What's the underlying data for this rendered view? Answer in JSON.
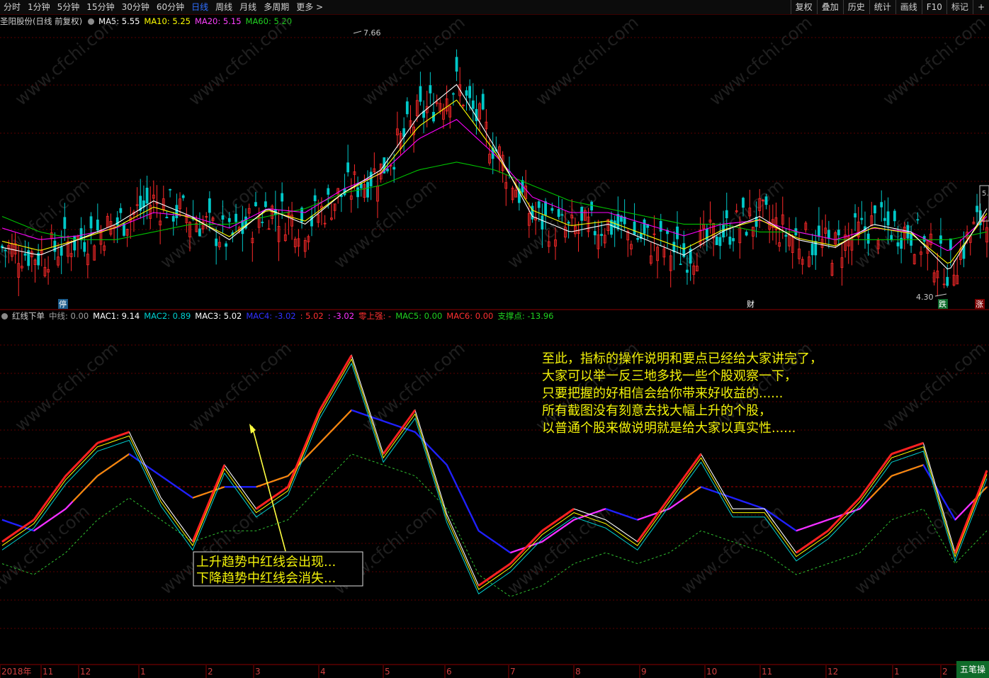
{
  "toolbar": {
    "periods": [
      "分时",
      "1分钟",
      "5分钟",
      "15分钟",
      "30分钟",
      "60分钟",
      "日线",
      "周线",
      "月线",
      "多周期",
      "更多 >"
    ],
    "active_period": "日线",
    "actions": [
      "复权",
      "叠加",
      "历史",
      "统计",
      "画线",
      "F10",
      "标记",
      "+"
    ]
  },
  "main_info": {
    "title": "圣阳股份(日线 前复权)",
    "ma5": "MA5: 5.55",
    "ma10": "MA10: 5.25",
    "ma20": "MA20: 5.15",
    "ma60": "MA60: 5.20",
    "high_label": "7.66",
    "low_label": "4.30",
    "right_axis_value": "5.",
    "markers": {
      "ting": "停",
      "cai": "财",
      "die": "跌",
      "zhang": "涨"
    }
  },
  "indicator_info": {
    "name": "红线下单",
    "zhongxian": "中线: 0.00",
    "mac1": "MAC1: 9.14",
    "mac2": "MAC2: 0.89",
    "mac3": "MAC3: 5.02",
    "mac4": "MAC4: -3.02",
    "v5": ": 5.02",
    "v6": ": -3.02",
    "lingshang": "零上强: -",
    "mac5": "MAC5: 0.00",
    "mac6": "MAC6: 0.00",
    "zhichengdian": "支撑点: -13.96"
  },
  "annotation_right": [
    "至此，指标的操作说明和要点已经给大家讲完了，",
    "大家可以举一反三地多找一些个股观察一下，",
    "只要把握的好相信会给你带来好收益的......",
    "所有截图没有刻意去找大幅上升的个股，",
    "以普通个股来做说明就是给大家以真实性......"
  ],
  "annotation_box": [
    "上升趋势中红线会出现...",
    "下降趋势中红线会消失..."
  ],
  "watermark": "www.cfchi.com",
  "xaxis": {
    "labels": [
      "2018年",
      "11",
      "12",
      "1",
      "2",
      "3",
      "4",
      "5",
      "6",
      "7",
      "8",
      "9",
      "10",
      "11",
      "12",
      "1",
      "2"
    ]
  },
  "bottom_tab": "五笔操",
  "colors": {
    "ma5": "#ffffff",
    "ma10": "#ffff00",
    "ma20": "#ff00ff",
    "ma60": "#00c000",
    "up": "#ff2a2a",
    "down": "#00c8c8",
    "red_line": "#ff2020",
    "orange_line": "#ff8a00",
    "blue_line": "#2020ff",
    "magenta_line": "#ff30ff",
    "green_dash": "#2fbf2f"
  },
  "chart_data": [
    {
      "type": "line",
      "title": "圣阳股份(日线 前复权)",
      "description_series": [
        {
          "name": "MA5",
          "values": [
            4.9,
            4.8,
            5.0,
            5.2,
            5.5,
            5.3,
            5.0,
            5.4,
            5.2,
            5.6,
            5.9,
            6.6,
            7.0,
            6.2,
            5.3,
            5.1,
            5.2,
            5.0,
            4.8,
            5.1,
            5.3,
            5.0,
            4.9,
            5.2,
            5.1,
            4.6,
            5.4
          ]
        },
        {
          "name": "MA60",
          "values": [
            5.3,
            5.1,
            5.0,
            5.0,
            5.1,
            5.2,
            5.2,
            5.3,
            5.4,
            5.6,
            5.7,
            5.9,
            6.0,
            5.9,
            5.7,
            5.5,
            5.4,
            5.3,
            5.2,
            5.2,
            5.1,
            5.1,
            5.0,
            5.0,
            5.0,
            5.0,
            5.1
          ]
        }
      ],
      "annotations": {
        "high": 7.66,
        "low": 4.3
      }
    },
    {
      "type": "line",
      "title": "红线下单",
      "series": [
        {
          "name": "MAC1",
          "values": [
            -8,
            -4,
            4,
            10,
            12,
            0,
            -8,
            6,
            -2,
            2,
            16,
            26,
            8,
            16,
            -3,
            -16,
            -12,
            -6,
            -2,
            -4,
            -8,
            0,
            8,
            -2,
            -2,
            -10,
            -6,
            0,
            8,
            10,
            -10,
            5
          ]
        },
        {
          "name": "MAC3",
          "values": [
            -4,
            -6,
            -2,
            4,
            8,
            4,
            0,
            2,
            2,
            4,
            10,
            16,
            14,
            12,
            6,
            -6,
            -10,
            -8,
            -4,
            -2,
            -4,
            -2,
            2,
            0,
            -2,
            -6,
            -4,
            -2,
            4,
            6,
            -4,
            2
          ]
        }
      ],
      "values_shown": {
        "MAC1": 9.14,
        "MAC2": 0.89,
        "MAC3": 5.02,
        "MAC4": -3.02,
        "支撑点": -13.96
      }
    }
  ]
}
